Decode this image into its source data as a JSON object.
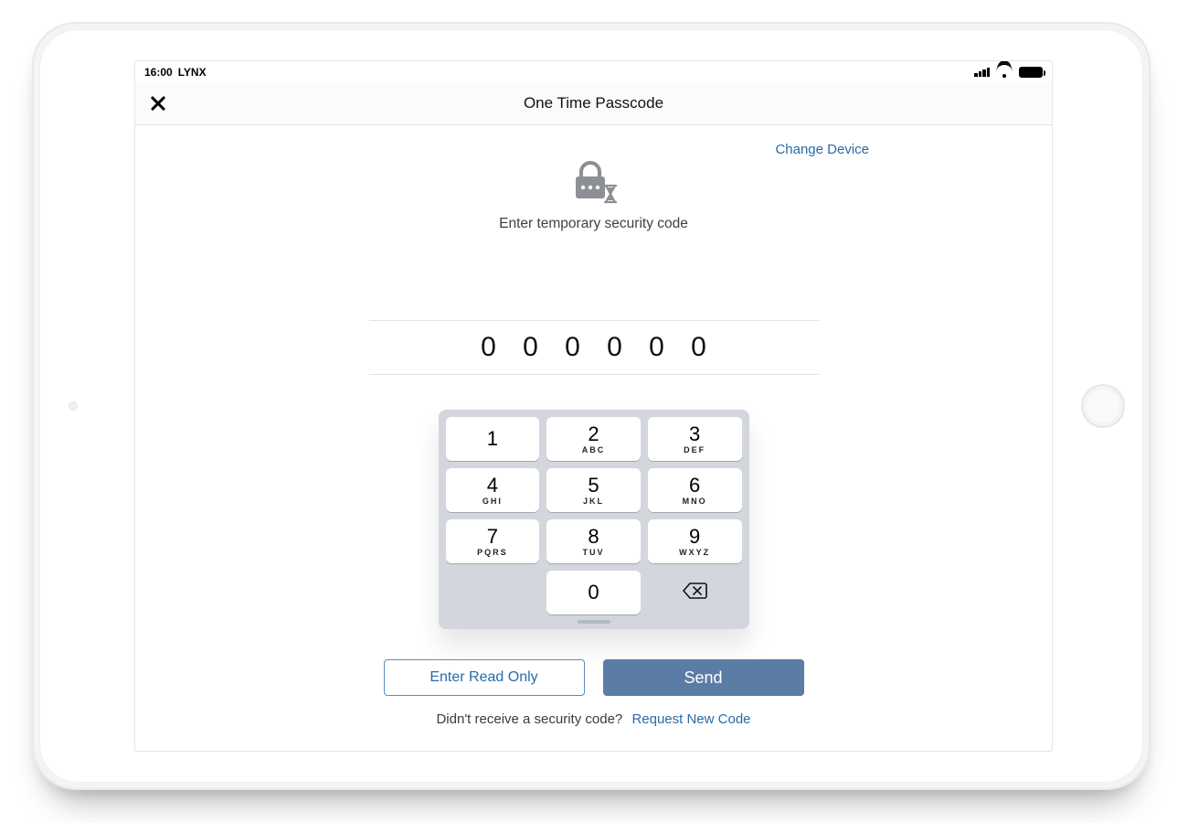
{
  "status": {
    "time": "16:00",
    "carrier": "LYNX"
  },
  "navbar": {
    "title": "One Time Passcode"
  },
  "main": {
    "change_device": "Change Device",
    "prompt": "Enter temporary security code",
    "code_digits": [
      "0",
      "0",
      "0",
      "0",
      "0",
      "0"
    ]
  },
  "keypad": {
    "keys": [
      {
        "num": "1",
        "letters": ""
      },
      {
        "num": "2",
        "letters": "ABC"
      },
      {
        "num": "3",
        "letters": "DEF"
      },
      {
        "num": "4",
        "letters": "GHI"
      },
      {
        "num": "5",
        "letters": "JKL"
      },
      {
        "num": "6",
        "letters": "MNO"
      },
      {
        "num": "7",
        "letters": "PQRS"
      },
      {
        "num": "8",
        "letters": "TUV"
      },
      {
        "num": "9",
        "letters": "WXYZ"
      },
      {
        "num": "0",
        "letters": ""
      }
    ]
  },
  "actions": {
    "read_only": "Enter Read Only",
    "send": "Send"
  },
  "footer": {
    "question": "Didn't receive a security code?",
    "link": "Request New Code"
  },
  "colors": {
    "accent": "#2a6aa8",
    "button_fill": "#5b7ca5"
  }
}
